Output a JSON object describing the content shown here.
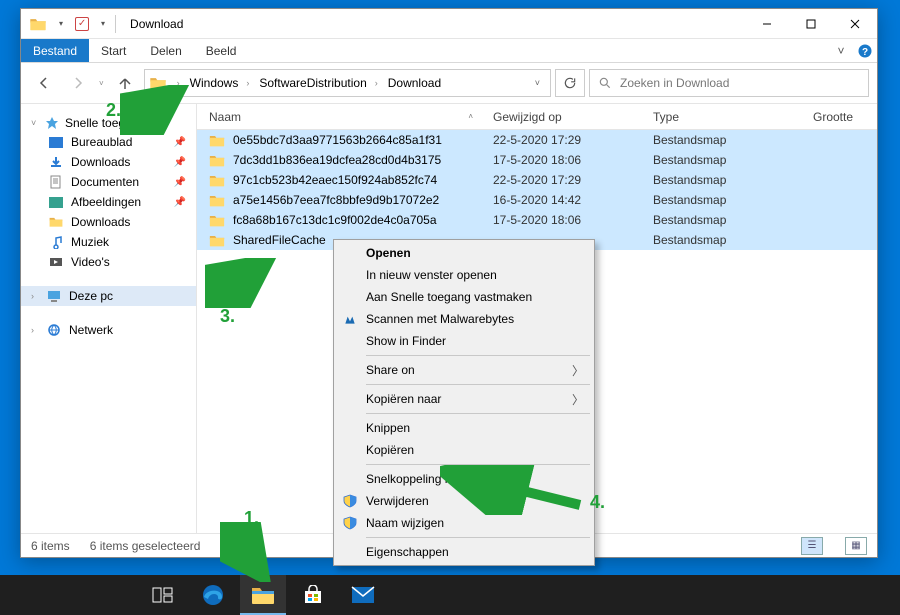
{
  "window": {
    "title": "Download",
    "controls": {
      "minimize": "–",
      "maximize": "☐",
      "close": "✕"
    }
  },
  "ribbon": {
    "file": "Bestand",
    "tabs": [
      "Start",
      "Delen",
      "Beeld"
    ]
  },
  "nav": {
    "back": "←",
    "forward": "→",
    "up": "↑"
  },
  "breadcrumb": {
    "items": [
      "Windows",
      "SoftwareDistribution",
      "Download"
    ]
  },
  "refresh": "⟳",
  "search": {
    "placeholder": "Zoeken in Download"
  },
  "sidebar": {
    "quick": {
      "label": "Snelle toegang",
      "items": [
        {
          "label": "Bureaublad",
          "pinned": true,
          "color": "#2a7bd4",
          "icon": "desktop"
        },
        {
          "label": "Downloads",
          "pinned": true,
          "color": "#2a7bd4",
          "icon": "downloads-arrow"
        },
        {
          "label": "Documenten",
          "pinned": true,
          "color": "#6b6b6b",
          "icon": "documents"
        },
        {
          "label": "Afbeeldingen",
          "pinned": true,
          "color": "#35a18f",
          "icon": "pictures"
        },
        {
          "label": "Downloads",
          "pinned": false,
          "color": "#e2a63a",
          "icon": "folder"
        },
        {
          "label": "Muziek",
          "pinned": false,
          "color": "#2a7bd4",
          "icon": "music"
        },
        {
          "label": "Video's",
          "pinned": false,
          "color": "#555555",
          "icon": "video"
        }
      ]
    },
    "this_pc": {
      "label": "Deze pc",
      "selected": true
    },
    "network": {
      "label": "Netwerk"
    }
  },
  "columns": {
    "name": "Naam",
    "modified": "Gewijzigd op",
    "type": "Type",
    "size": "Grootte"
  },
  "rows": [
    {
      "name": "0e55bdc7d3aa9771563b2664c85a1f31",
      "modified": "22-5-2020 17:29",
      "type": "Bestandsmap"
    },
    {
      "name": "7dc3dd1b836ea19dcfea28cd0d4b3175",
      "modified": "17-5-2020 18:06",
      "type": "Bestandsmap"
    },
    {
      "name": "97c1cb523b42eaec150f924ab852fc74",
      "modified": "22-5-2020 17:29",
      "type": "Bestandsmap"
    },
    {
      "name": "a75e1456b7eea7fc8bbfe9d9b17072e2",
      "modified": "16-5-2020 14:42",
      "type": "Bestandsmap"
    },
    {
      "name": "fc8a68b167c13dc1c9f002de4c0a705a",
      "modified": "17-5-2020 18:06",
      "type": "Bestandsmap"
    },
    {
      "name": "SharedFileCache",
      "modified": "",
      "type": "Bestandsmap"
    }
  ],
  "status": {
    "items": "6 items",
    "selected": "6 items geselecteerd"
  },
  "context_menu": {
    "open": "Openen",
    "new_window": "In nieuw venster openen",
    "pin_quick": "Aan Snelle toegang vastmaken",
    "scan_malware": "Scannen met Malwarebytes",
    "show_finder": "Show in Finder",
    "share_on": "Share on",
    "copy_to": "Kopiëren naar",
    "cut": "Knippen",
    "copy": "Kopiëren",
    "shortcut": "Snelkoppeling maken",
    "delete": "Verwijderen",
    "rename": "Naam wijzigen",
    "properties": "Eigenschappen"
  },
  "annotations": {
    "a1": "1.",
    "a2": "2.",
    "a3": "3.",
    "a4": "4."
  }
}
